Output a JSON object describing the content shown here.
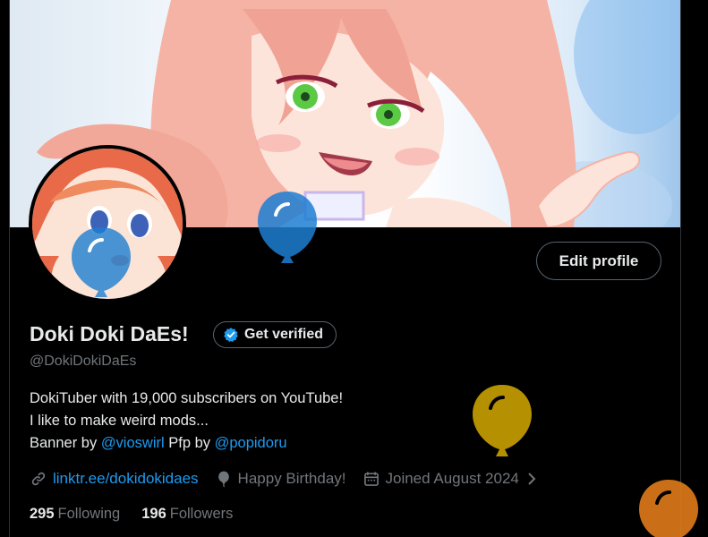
{
  "profile": {
    "display_name": "Doki Doki DaEs!",
    "handle": "@DokiDokiDaEs",
    "get_verified_label": "Get verified",
    "edit_profile_label": "Edit profile",
    "bio": {
      "line1": "DokiTuber with 19,000 subscribers on YouTube!",
      "line2": "I like to make weird mods...",
      "line3_prefix": "Banner by ",
      "line3_mention1": "@vioswirl",
      "line3_middle": " Pfp by ",
      "line3_mention2": "@popidoru"
    },
    "meta": {
      "website": "linktr.ee/dokidokidaes",
      "birthday": "Happy Birthday!",
      "joined": "Joined August 2024"
    },
    "stats": {
      "following_count": "295",
      "following_label": "Following",
      "followers_count": "196",
      "followers_label": "Followers"
    }
  },
  "colors": {
    "background": "#000000",
    "text_primary": "#e7e9ea",
    "text_secondary": "#71767b",
    "accent": "#1d9bf0",
    "border": "#536471"
  },
  "balloons": [
    "blue",
    "blue",
    "gold",
    "orange"
  ]
}
